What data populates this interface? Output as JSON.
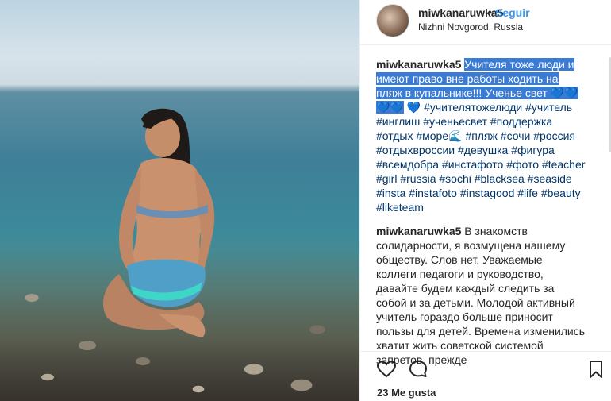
{
  "header": {
    "username": "miwkanaruwka5",
    "separator": "•",
    "follow_label": "Seguir",
    "location": "Nizhni Novgorod, Russia"
  },
  "caption": {
    "username": "miwkanaruwka5",
    "highlighted_text": "Учителя тоже люди и имеют право вне работы ходить на пляж в купальнике!!! Ученье свет",
    "hearts": "💙💙💙💙",
    "trailing_heart": "💙",
    "hashtags_line1": "#учителятожелюди #учитель #инглиш #ученьесвет #поддержка #отдых #море",
    "wave_emoji": "🌊",
    "hashtags_line2": "#пляж #сочи #россия #отдыхвроссии #девушка #фигура #всемдобра #инстафото #фото #teacher #girl #russia #sochi #blacksea #seaside #insta #instafoto #instagood #life #beauty #liketeam"
  },
  "comment": {
    "username": "miwkanaruwka5",
    "text": "В знакомств солидарности, я возмущена нашему обществу. Слов нет. Уважаемые коллеги педагоги и руководство, давайте будем каждый следить за собой и за детьми. Молодой активный учитель гораздо больше приносит пользы для детей. Времена изменились хватит жить советской системой запретов, прежде"
  },
  "actions": {
    "like_icon": "heart-icon",
    "comment_icon": "comment-icon",
    "save_icon": "bookmark-icon"
  },
  "likes_text": "23 Me gusta",
  "colors": {
    "link": "#3897f0",
    "hashtag": "#003569",
    "selection": "#3a7bd5",
    "text": "#262626"
  }
}
